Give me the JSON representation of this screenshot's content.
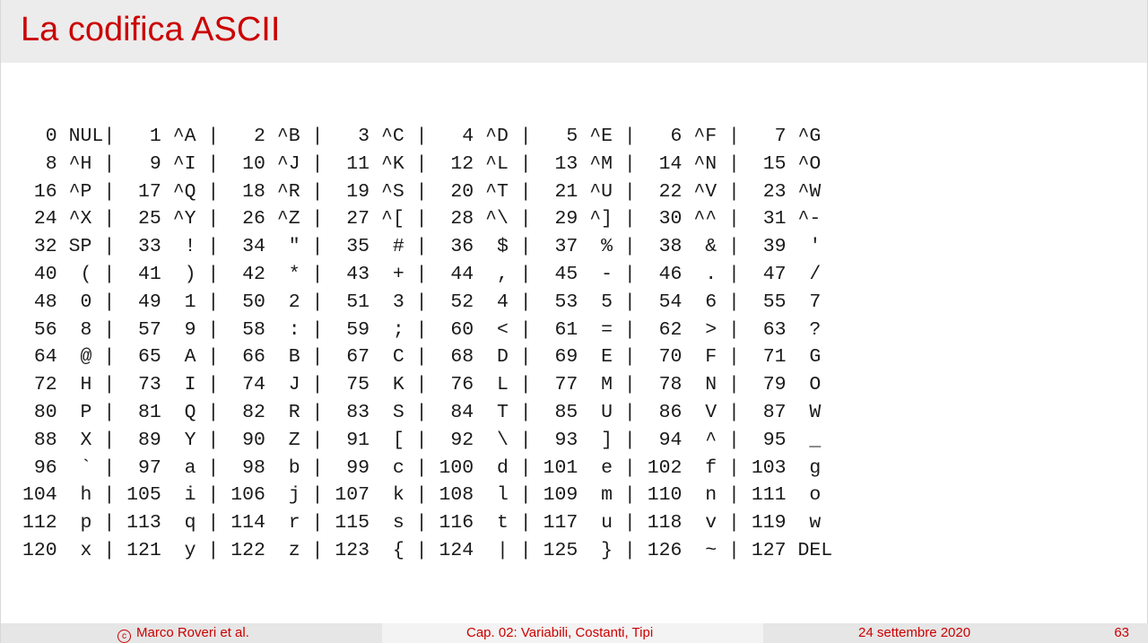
{
  "slide": {
    "title": "La codifica ASCII"
  },
  "ascii_table": {
    "rows": [
      "  0 NUL|   1 ^A |   2 ^B |   3 ^C |   4 ^D |   5 ^E |   6 ^F |   7 ^G",
      "  8 ^H |   9 ^I |  10 ^J |  11 ^K |  12 ^L |  13 ^M |  14 ^N |  15 ^O",
      " 16 ^P |  17 ^Q |  18 ^R |  19 ^S |  20 ^T |  21 ^U |  22 ^V |  23 ^W",
      " 24 ^X |  25 ^Y |  26 ^Z |  27 ^[ |  28 ^\\ |  29 ^] |  30 ^^ |  31 ^-",
      " 32 SP |  33  ! |  34  \" |  35  # |  36  $ |  37  % |  38  & |  39  '",
      " 40  ( |  41  ) |  42  * |  43  + |  44  , |  45  - |  46  . |  47  /",
      " 48  0 |  49  1 |  50  2 |  51  3 |  52  4 |  53  5 |  54  6 |  55  7",
      " 56  8 |  57  9 |  58  : |  59  ; |  60  < |  61  = |  62  > |  63  ?",
      " 64  @ |  65  A |  66  B |  67  C |  68  D |  69  E |  70  F |  71  G",
      " 72  H |  73  I |  74  J |  75  K |  76  L |  77  M |  78  N |  79  O",
      " 80  P |  81  Q |  82  R |  83  S |  84  T |  85  U |  86  V |  87  W",
      " 88  X |  89  Y |  90  Z |  91  [ |  92  \\ |  93  ] |  94  ^ |  95  _",
      " 96  ` |  97  a |  98  b |  99  c | 100  d | 101  e | 102  f | 103  g",
      "104  h | 105  i | 106  j | 107  k | 108  l | 109  m | 110  n | 111  o",
      "112  p | 113  q | 114  r | 115  s | 116  t | 117  u | 118  v | 119  w",
      "120  x | 121  y | 122  z | 123  { | 124  | | 125  } | 126  ~ | 127 DEL"
    ]
  },
  "footer": {
    "copyright_symbol": "c",
    "author": "Marco Roveri et al.",
    "chapter": "Cap. 02: Variabili, Costanti, Tipi",
    "date": "24 settembre 2020",
    "page": "63"
  },
  "colors": {
    "accent": "#cc0000",
    "header_bg": "#ececec",
    "text": "#1a1a1a"
  }
}
